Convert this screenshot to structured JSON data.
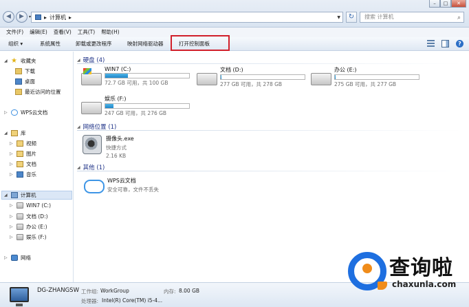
{
  "window": {
    "breadcrumb": [
      "计算机"
    ],
    "search_placeholder": "搜索 计算机",
    "buttons": [
      "–",
      "□",
      "✕"
    ]
  },
  "menu": [
    "文件(F)",
    "编辑(E)",
    "查看(V)",
    "工具(T)",
    "帮助(H)"
  ],
  "toolbar": {
    "organize": "组织 ▾",
    "system_properties": "系统属性",
    "uninstall": "卸载或更改程序",
    "map_drive": "映射网络驱动器",
    "open_control_panel": "打开控制面板"
  },
  "sidebar": {
    "favorites": "收藏夹",
    "downloads": "下载",
    "desktop": "桌面",
    "recent": "最近访问的位置",
    "wps": "WPS云文档",
    "libraries": "库",
    "videos": "视频",
    "pictures": "图片",
    "documents": "文档",
    "music": "音乐",
    "computer": "计算机",
    "drive_c": "WIN7 (C:)",
    "drive_d": "文档 (D:)",
    "drive_e": "办公 (E:)",
    "drive_f": "娱乐 (F:)",
    "network": "网络"
  },
  "main": {
    "hdd_group": "硬盘 (4)",
    "net_group": "网络位置 (1)",
    "other_group": "其他 (1)",
    "drives": [
      {
        "name": "WIN7 (C:)",
        "free": "72.7 GB 可用，共 100 GB",
        "used_fraction": 0.27
      },
      {
        "name": "文档 (D:)",
        "free": "277 GB 可用，共 278 GB",
        "used_fraction": 0.004
      },
      {
        "name": "办公 (E:)",
        "free": "275 GB 可用，共 277 GB",
        "used_fraction": 0.007
      },
      {
        "name": "娱乐 (F:)",
        "free": "247 GB 可用，共 276 GB",
        "used_fraction": 0.1
      }
    ],
    "camera": {
      "name": "摄像头.exe",
      "type": "快捷方式",
      "size": "2.16 KB"
    },
    "wps": {
      "name": "WPS云文档",
      "desc": "安全可靠，文件不丢失"
    }
  },
  "status": {
    "pc_name": "DG-ZHANGSW",
    "workgroup_label": "工作组:",
    "workgroup": "WorkGroup",
    "memory_label": "内存:",
    "memory": "8.00 GB",
    "cpu_label": "处理器:",
    "cpu": "Intel(R) Core(TM) i5-4..."
  },
  "watermark": {
    "title": "查询啦",
    "url": "chaxunla.com"
  }
}
